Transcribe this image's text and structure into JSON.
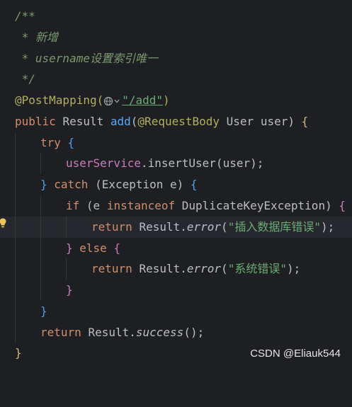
{
  "editor": {
    "lines": {
      "l1": {
        "c": "/**"
      },
      "l2": {
        "c": " * 新增"
      },
      "l3": {
        "c": " * username设置索引唯一"
      },
      "l4": {
        "c": " */"
      },
      "l5": {
        "ann": "@PostMapping(",
        "url": "\"/add\"",
        "close": ")"
      },
      "l6": {
        "kw": "public ",
        "type": "Result ",
        "fn": "add",
        "p1": "(",
        "ann": "@RequestBody ",
        "rest": "User user) ",
        "brace": "{"
      },
      "l7": {
        "kw": "try ",
        "brace": "{"
      },
      "l8": {
        "field": "userService",
        "rest": ".insertUser(user);"
      },
      "l9": {
        "brace1": "} ",
        "kw": "catch ",
        "rest": "(Exception e) ",
        "brace2": "{"
      },
      "l10": {
        "kw": "if ",
        "p1": "(e ",
        "kw2": "instanceof ",
        "rest": "DuplicateKeyException) ",
        "brace": "{"
      },
      "l11": {
        "kw": "return ",
        "cls": "Result.",
        "method": "error",
        "p1": "(",
        "str": "\"插入数据库错误\"",
        "end": ");"
      },
      "l12": {
        "brace1": "} ",
        "kw": "else ",
        "brace2": "{"
      },
      "l13": {
        "kw": "return ",
        "cls": "Result.",
        "method": "error",
        "p1": "(",
        "str": "\"系统错误\"",
        "end": ");"
      },
      "l14": {
        "brace": "}"
      },
      "l15": {
        "brace": "}"
      },
      "l16": {
        "kw": "return ",
        "cls": "Result.",
        "method": "success",
        "end": "();"
      },
      "l17": {
        "brace": "}"
      }
    },
    "gutter_icon": "lightbulb-icon",
    "inline_icon": "web-globe-icon"
  },
  "watermark": "CSDN @Eliauk544",
  "colors": {
    "background": "#1e1f22",
    "current_line": "#26282e",
    "comment": "#7a9a6e",
    "keyword": "#cf8e6d",
    "annotation": "#b3ae60",
    "string": "#6aab73",
    "function": "#56a8f5",
    "field": "#c77dbb"
  }
}
